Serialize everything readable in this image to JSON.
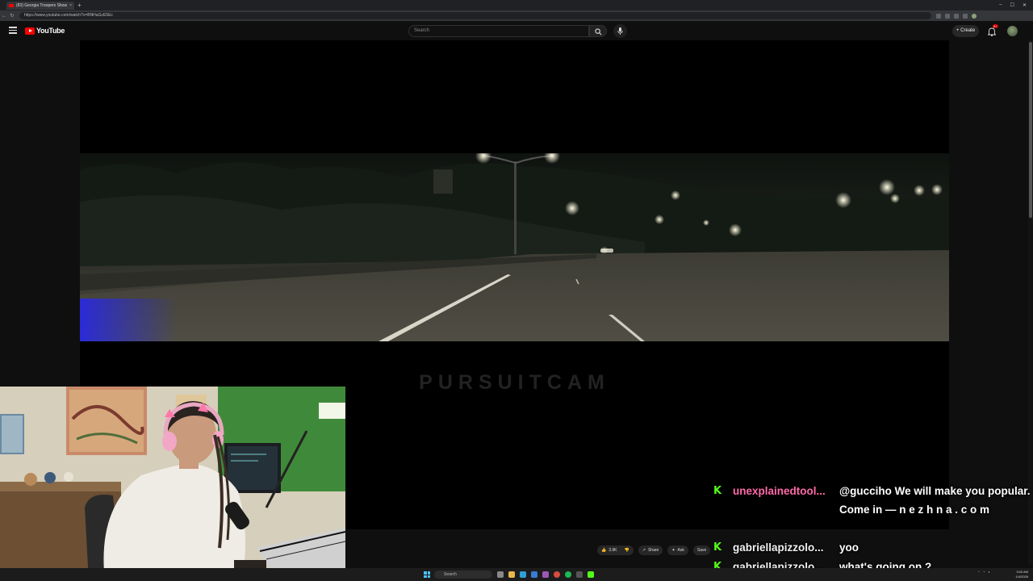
{
  "browser": {
    "tab_title": "(83) Georgia Troopers Show",
    "url": "https://www.youtube.com/watch?v=BNHaGcE5Ec",
    "new_tab_symbol": "+",
    "window_controls": [
      "–",
      "☐",
      "✕"
    ]
  },
  "youtube": {
    "logo_text": "YouTube",
    "search_placeholder": "Search",
    "create_label": "Create",
    "notification_count": "9+"
  },
  "video": {
    "watermark": "PURSUITCAM"
  },
  "controls": {
    "likes": "3.9K",
    "share_label": "Share",
    "ask_label": "Ask",
    "save_label": "Save"
  },
  "chat": [
    {
      "username": "unexplainedtool...",
      "username_color": "#ff6aa8",
      "message": "@gucciho We will make you popular. Come in — n e z h n a . c o m"
    },
    {
      "username": "gabriellapizzolo...",
      "username_color": "#f1f1f1",
      "message": "yoo"
    },
    {
      "username": "gabriellapizzolo...",
      "username_color": "#f1f1f1",
      "message": "what's going on ?"
    }
  ],
  "taskbar": {
    "search_placeholder": "Search",
    "time": "3:00 AM",
    "date": "1/4/2026"
  },
  "colors": {
    "kick_green": "#53fc18",
    "youtube_red": "#ff0000",
    "windows_accent": "#4cc2ff"
  }
}
